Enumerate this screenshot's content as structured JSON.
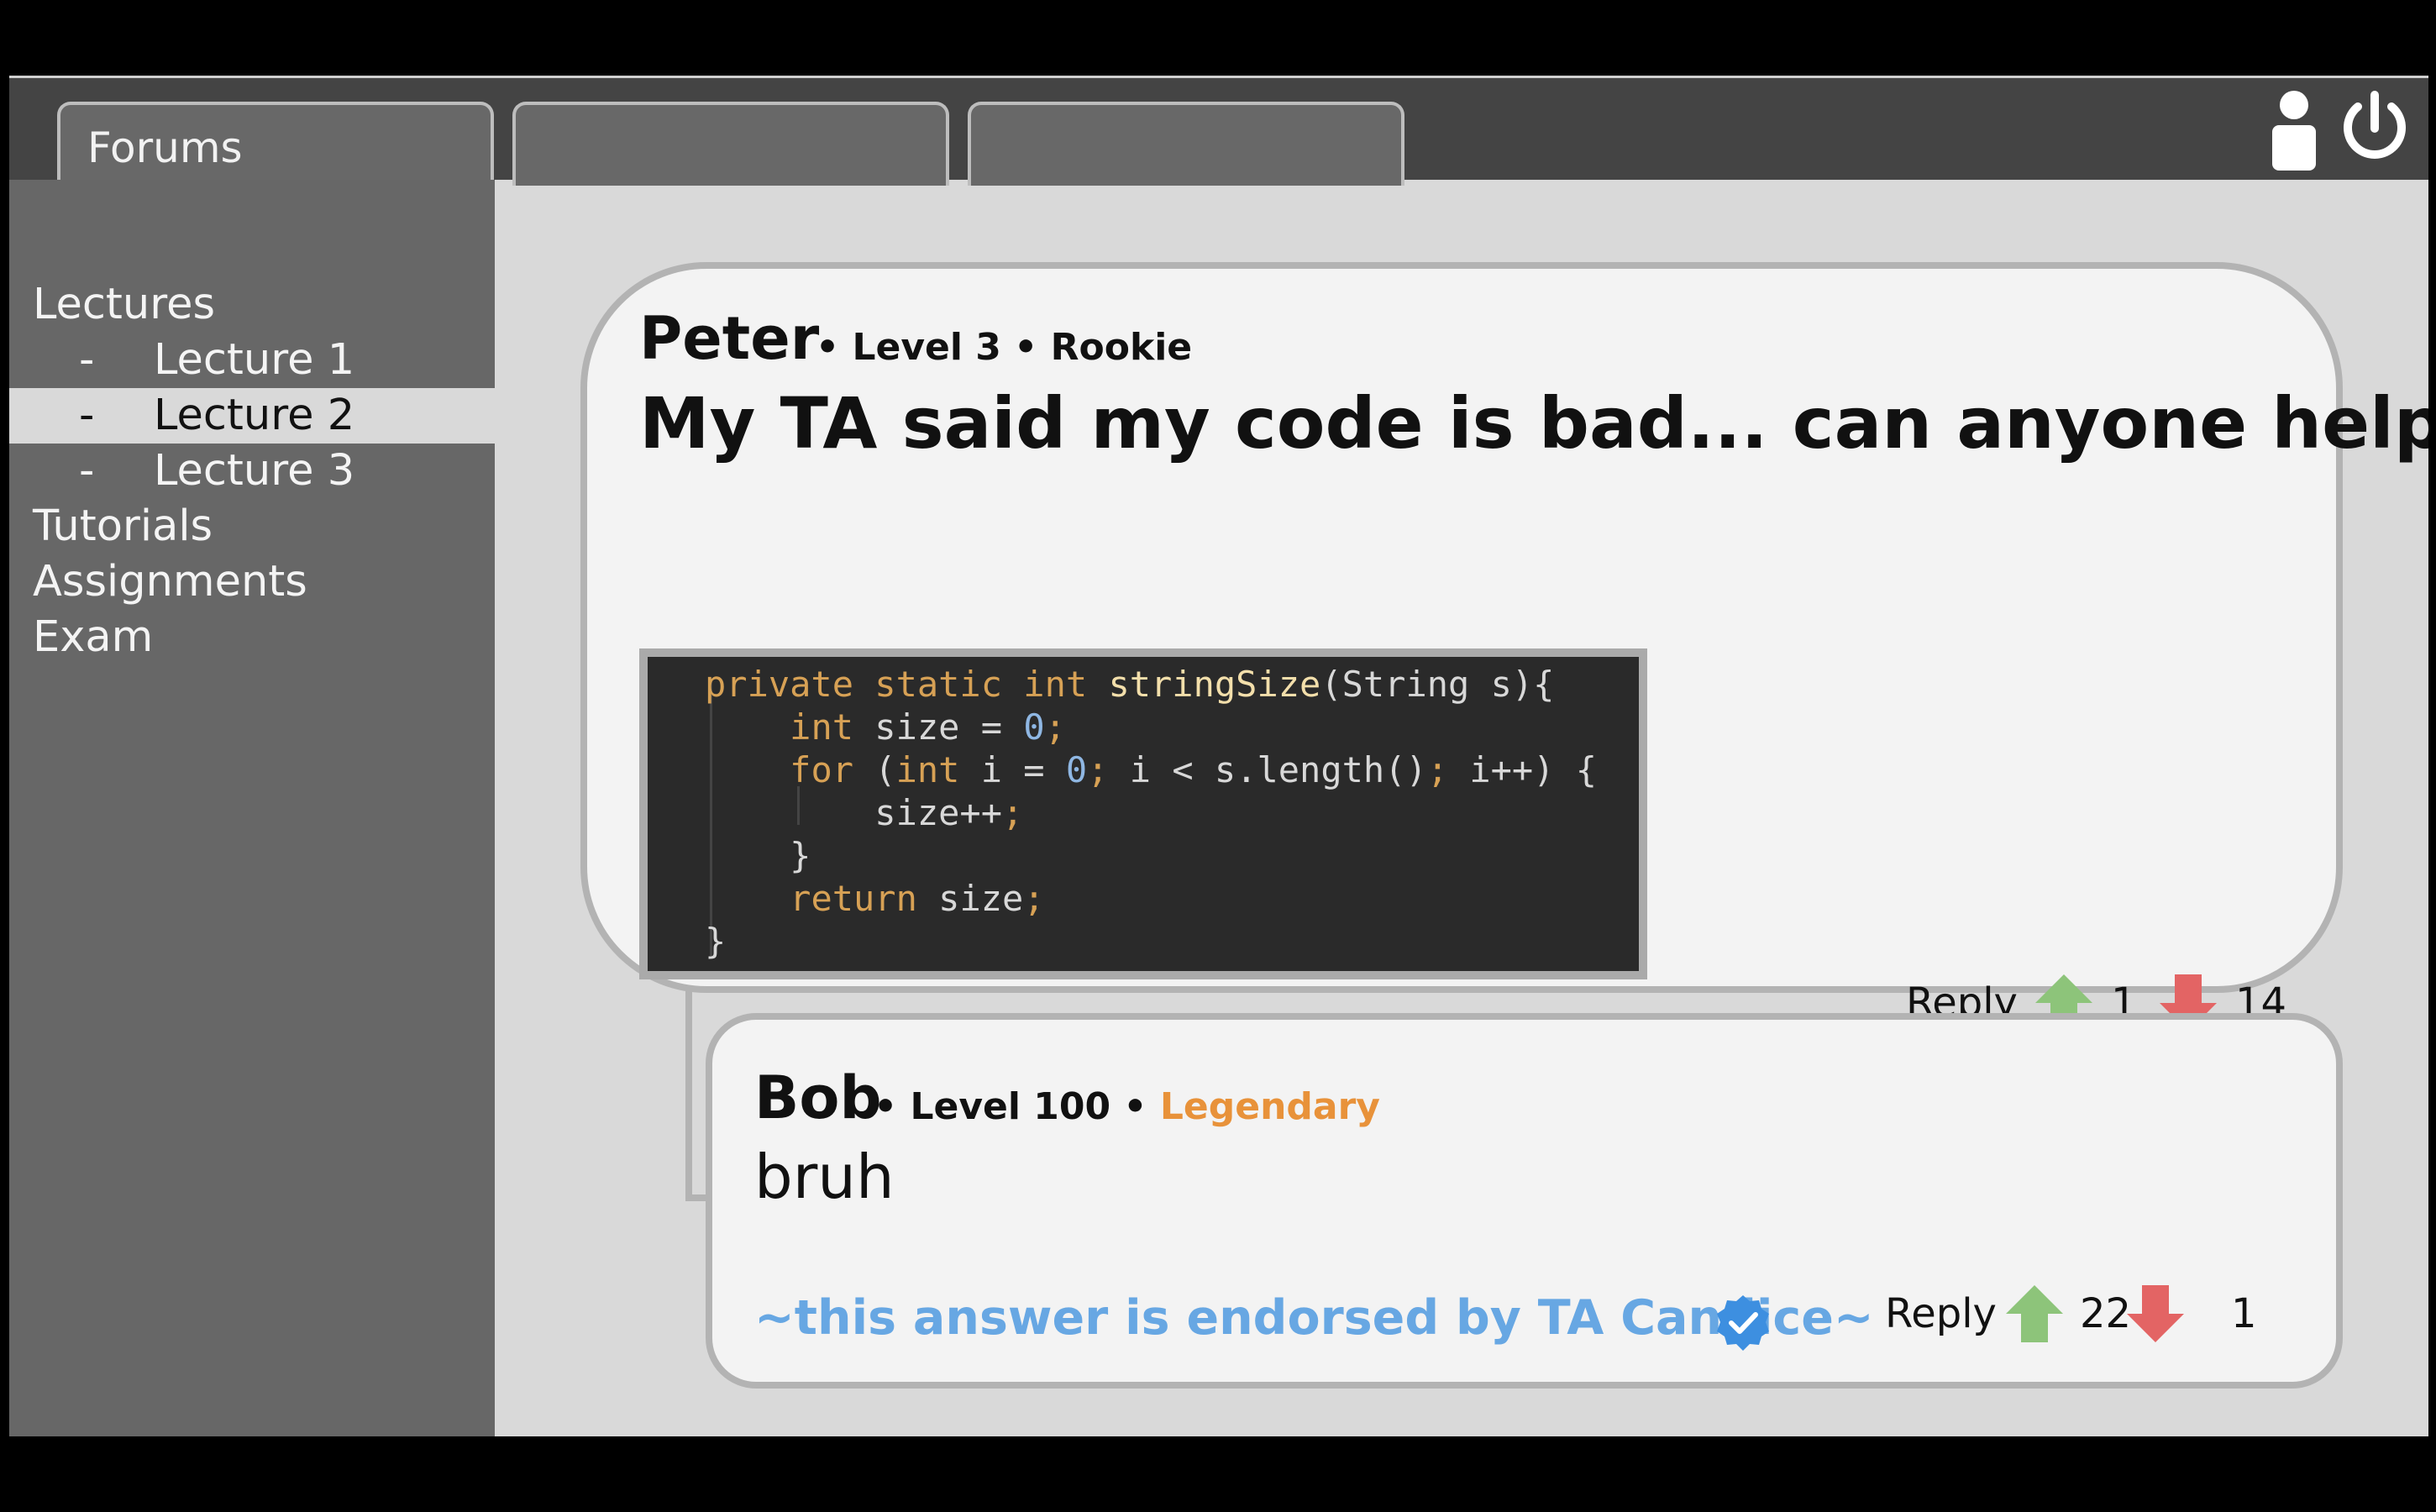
{
  "tabs": [
    {
      "label": "Forums"
    },
    {
      "label": ""
    },
    {
      "label": ""
    }
  ],
  "header_icons": {
    "user": "user-icon",
    "power": "power-icon"
  },
  "sidebar": {
    "items": [
      {
        "label": "Lectures",
        "level": 0,
        "active": false
      },
      {
        "dash": "-",
        "label": "Lecture 1",
        "level": 1,
        "active": false
      },
      {
        "dash": "-",
        "label": "Lecture 2",
        "level": 1,
        "active": true
      },
      {
        "dash": "-",
        "label": "Lecture 3",
        "level": 1,
        "active": false
      },
      {
        "label": "Tutorials",
        "level": 0,
        "active": false
      },
      {
        "label": "Assignments",
        "level": 0,
        "active": false
      },
      {
        "label": "Exam",
        "level": 0,
        "active": false
      }
    ]
  },
  "post": {
    "author": "Peter",
    "meta": "• Level 3 • Rookie",
    "title": "My TA said my code is bad... can anyone help?",
    "code": [
      "private static int stringSize(String s){",
      "    int size = 0;",
      "    for (int i = 0; i < s.length(); i++) {",
      "        size++;",
      "    }",
      "    return size;",
      "}"
    ],
    "reply_label": "Reply",
    "upvotes": "1",
    "downvotes": "14"
  },
  "reply": {
    "author": "Bob",
    "meta_prefix": "• Level 100 •",
    "rank": "Legendary",
    "body": "bruh",
    "endorsement": "~this answer is endorsed by TA Candice~",
    "reply_label": "Reply",
    "upvotes": "22",
    "downvotes": "1"
  },
  "colors": {
    "topbar": "#444444",
    "sidebar": "#676767",
    "content_bg": "#d9d9d9",
    "card_bg": "#f3f3f3",
    "card_border": "#b3b3b3",
    "rank_legendary": "#e8923a",
    "endorse": "#67a7e3",
    "upvote": "#8dc47a",
    "downvote": "#e36464"
  }
}
